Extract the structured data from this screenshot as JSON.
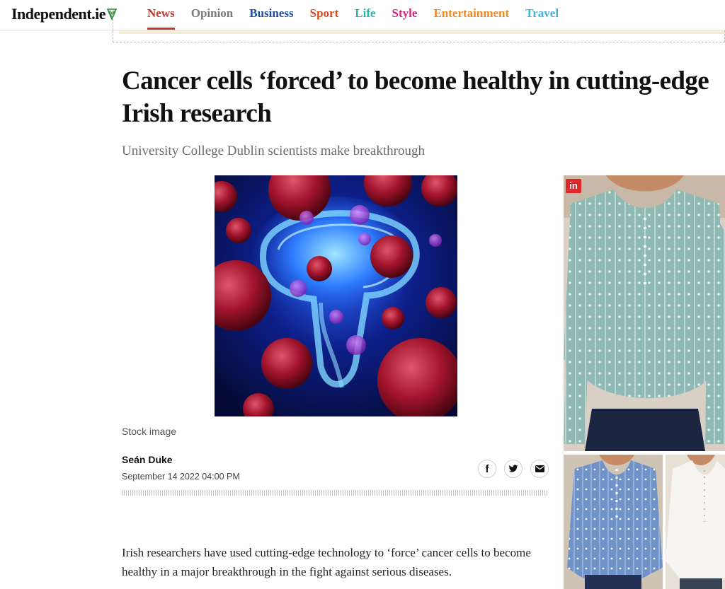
{
  "header": {
    "logo_text": "Independent.ie",
    "logo_icon": "harp-icon",
    "nav": [
      {
        "label": "News",
        "color": "#c0392b",
        "active": true
      },
      {
        "label": "Opinion",
        "color": "#7a7a7a"
      },
      {
        "label": "Business",
        "color": "#1f4fa0"
      },
      {
        "label": "Sport",
        "color": "#e0461b"
      },
      {
        "label": "Life",
        "color": "#26b5a8"
      },
      {
        "label": "Style",
        "color": "#d6257a"
      },
      {
        "label": "Entertainment",
        "color": "#f08a24"
      },
      {
        "label": "Travel",
        "color": "#3fb2de"
      }
    ]
  },
  "article": {
    "headline": "Cancer cells ‘forced’ to become healthy in cutting-edge Irish research",
    "standfirst": "University College Dublin scientists make breakthrough",
    "image_caption": "Stock image",
    "author": "Seán Duke",
    "date": "September 14 2022 04:00 PM",
    "body": "Irish researchers have used cutting-edge technology to ‘force’ cancer cells to become healthy in a major breakthrough in the fight against serious diseases."
  },
  "share": [
    {
      "icon": "facebook-icon",
      "glyph": "f"
    },
    {
      "icon": "twitter-icon",
      "glyph": "t"
    },
    {
      "icon": "email-icon",
      "glyph": "✉"
    }
  ],
  "ad": {
    "badge_text": "in"
  }
}
